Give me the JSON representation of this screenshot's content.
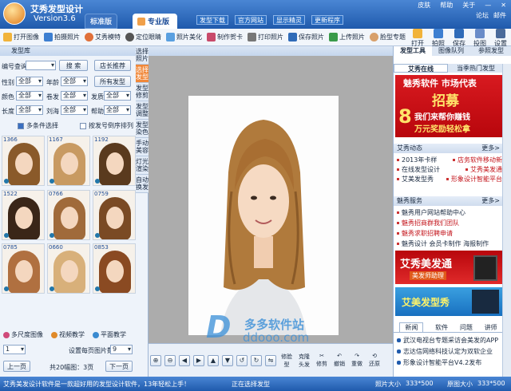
{
  "app": {
    "name": "艾秀发型设计",
    "version": "Version3.6",
    "tab_pro": "专业版",
    "tab_std": "标准版"
  },
  "topbar": {
    "buttons": [
      "发型下载",
      "官方网站",
      "显示精灵",
      "更新程序"
    ],
    "links": [
      "皮肤",
      "帮助",
      "关于"
    ],
    "tools": [
      "论坛",
      "邮件"
    ]
  },
  "toolbar": {
    "items": [
      "打开图像",
      "拍摄照片",
      "艾秀模特",
      "定位眼睛",
      "照片美化",
      "制作贺卡",
      "打印照片",
      "保存照片",
      "上传照片",
      "脸型专题"
    ],
    "right": [
      "打开",
      "拍照",
      "保存",
      "投图",
      "设置"
    ]
  },
  "left": {
    "header": "发型库",
    "labels": {
      "code": "编号查询",
      "gender": "性别",
      "age": "年龄",
      "color": "颜色",
      "curl": "卷发",
      "length": "长度",
      "bangs": "刘海",
      "type": "发质",
      "feature": "帮助"
    },
    "search_btn": "搜 索",
    "store_btn": "店长推荐",
    "all_btn": "所有发型",
    "all_opt": "全部",
    "chk1": "多条件选择",
    "chk2": "按发号倒序排列",
    "vtabs": [
      "选择照片",
      "选择发型",
      "发型修剪",
      "发型调整",
      "发型染色",
      "手动美容",
      "灯光渲染",
      "自动换发"
    ],
    "thumbs": [
      "1366",
      "1167",
      "1192",
      "1522",
      "0766",
      "0759",
      "0785",
      "0660",
      "0853"
    ],
    "features": [
      "多尺度图像",
      "视频教学",
      "平面教学"
    ],
    "page_size_label": "设置每页图片数",
    "page_size": "9",
    "first_val": "1",
    "prev": "上一页",
    "next": "下一页",
    "page_info": "共20幅图：3页"
  },
  "canvas": {
    "wm_name": "多多软件站",
    "wm_url": "ddooo.com",
    "tools_labels": [
      "修脸型",
      "克隆头发",
      "修剪",
      "撤销",
      "重做",
      "还原"
    ]
  },
  "right": {
    "tabs": [
      "发型工具",
      "图像队列",
      "参照发型"
    ],
    "subtabs": [
      "艾秀在线",
      "当季热门发型"
    ],
    "banner": {
      "title": "魅秀软件 市场代表",
      "big": "招募",
      "line1": "我们来帮你赚钱",
      "line2": "万元奖励轻松拿",
      "num": "8"
    },
    "news_head": "艾秀动态",
    "more": "更多>",
    "news": [
      [
        "2013年卡样",
        "店务软件移动新"
      ],
      [
        "在线发型设计",
        "艾秀美发通"
      ],
      [
        "艾美发型秀",
        "形象设计智能平台"
      ]
    ],
    "svc_head": "魅秀服务",
    "svc": [
      "魅秀用户网站帮助中心",
      "魅秀招商群我们团队",
      "魅秀求职招聘申请",
      "魅秀设计 会员卡制作 海报制作"
    ],
    "promo1": "艾秀美发通",
    "promo1_sub": "美发师助理",
    "promo2": "艾美发型秀",
    "btabs": [
      "新闻",
      "软件",
      "问题",
      "讲师"
    ],
    "blist": [
      "武汉电视台专题采访会美发的APP",
      "志达信网络科技认定为双软企业",
      "形象设计智能平台V4.2发布"
    ]
  },
  "status": {
    "left": "艾秀美发设计软件是一款超好用的发型设计软件，13年轻松上手！",
    "center": "正在选择发型",
    "r1": "照片大小",
    "v1": "333*500",
    "r2": "原图大小",
    "v2": "333*500"
  },
  "colors": {
    "accent": "#1f5aac",
    "orange": "#f0883a",
    "red": "#c3131a"
  }
}
